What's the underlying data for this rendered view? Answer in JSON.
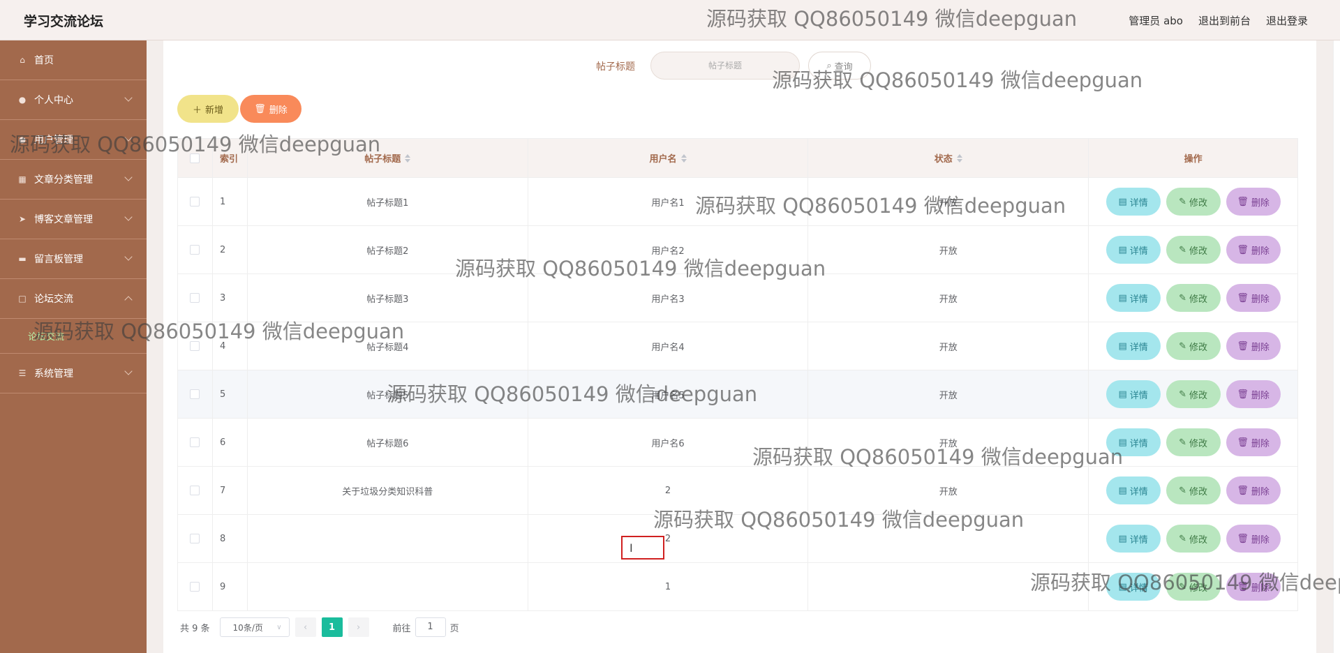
{
  "app": {
    "title": "学习交流论坛"
  },
  "header": {
    "user": "管理员 abo",
    "to_front": "退出到前台",
    "logout": "退出登录"
  },
  "sidebar": {
    "items": [
      {
        "label": "首页",
        "icon": "home-icon"
      },
      {
        "label": "个人中心",
        "icon": "user-icon"
      },
      {
        "label": "用户管理",
        "icon": "users-icon"
      },
      {
        "label": "文章分类管理",
        "icon": "grid-icon"
      },
      {
        "label": "博客文章管理",
        "icon": "send-icon"
      },
      {
        "label": "留言板管理",
        "icon": "message-icon"
      },
      {
        "label": "论坛交流",
        "icon": "forum-icon"
      }
    ],
    "sub_item": "论坛交流",
    "last": {
      "label": "系统管理",
      "icon": "menu-icon"
    }
  },
  "search": {
    "label": "帖子标题",
    "placeholder": "帖子标题",
    "button": "查询"
  },
  "toolbar": {
    "add": "新增",
    "delete": "删除"
  },
  "table": {
    "columns": {
      "index": "索引",
      "title": "帖子标题",
      "user": "用户名",
      "status": "状态",
      "ops": "操作"
    },
    "rows": [
      {
        "idx": "1",
        "title": "帖子标题1",
        "user": "用户名1",
        "status": "开放"
      },
      {
        "idx": "2",
        "title": "帖子标题2",
        "user": "用户名2",
        "status": "开放"
      },
      {
        "idx": "3",
        "title": "帖子标题3",
        "user": "用户名3",
        "status": "开放"
      },
      {
        "idx": "4",
        "title": "帖子标题4",
        "user": "用户名4",
        "status": "开放"
      },
      {
        "idx": "5",
        "title": "帖子标题5",
        "user": "用户名5",
        "status": "开放"
      },
      {
        "idx": "6",
        "title": "帖子标题6",
        "user": "用户名6",
        "status": "开放"
      },
      {
        "idx": "7",
        "title": "关于垃圾分类知识科普",
        "user": "2",
        "status": "开放"
      },
      {
        "idx": "8",
        "title": "",
        "user": "2",
        "status": ""
      },
      {
        "idx": "9",
        "title": "",
        "user": "1",
        "status": ""
      }
    ],
    "ops": {
      "detail": "详情",
      "edit": "修改",
      "remove": "删除"
    }
  },
  "pager": {
    "total": "共 9 条",
    "page_size": "10条/页",
    "current": "1",
    "goto_label": "前往",
    "goto_value": "1",
    "page_suffix": "页"
  },
  "watermark": "源码获取 QQ86050149 微信deepguan",
  "colors": {
    "sidebar": "#a2694c",
    "accent": "#1abc9c",
    "delete": "#f98a5a",
    "add": "#f1e38a"
  }
}
